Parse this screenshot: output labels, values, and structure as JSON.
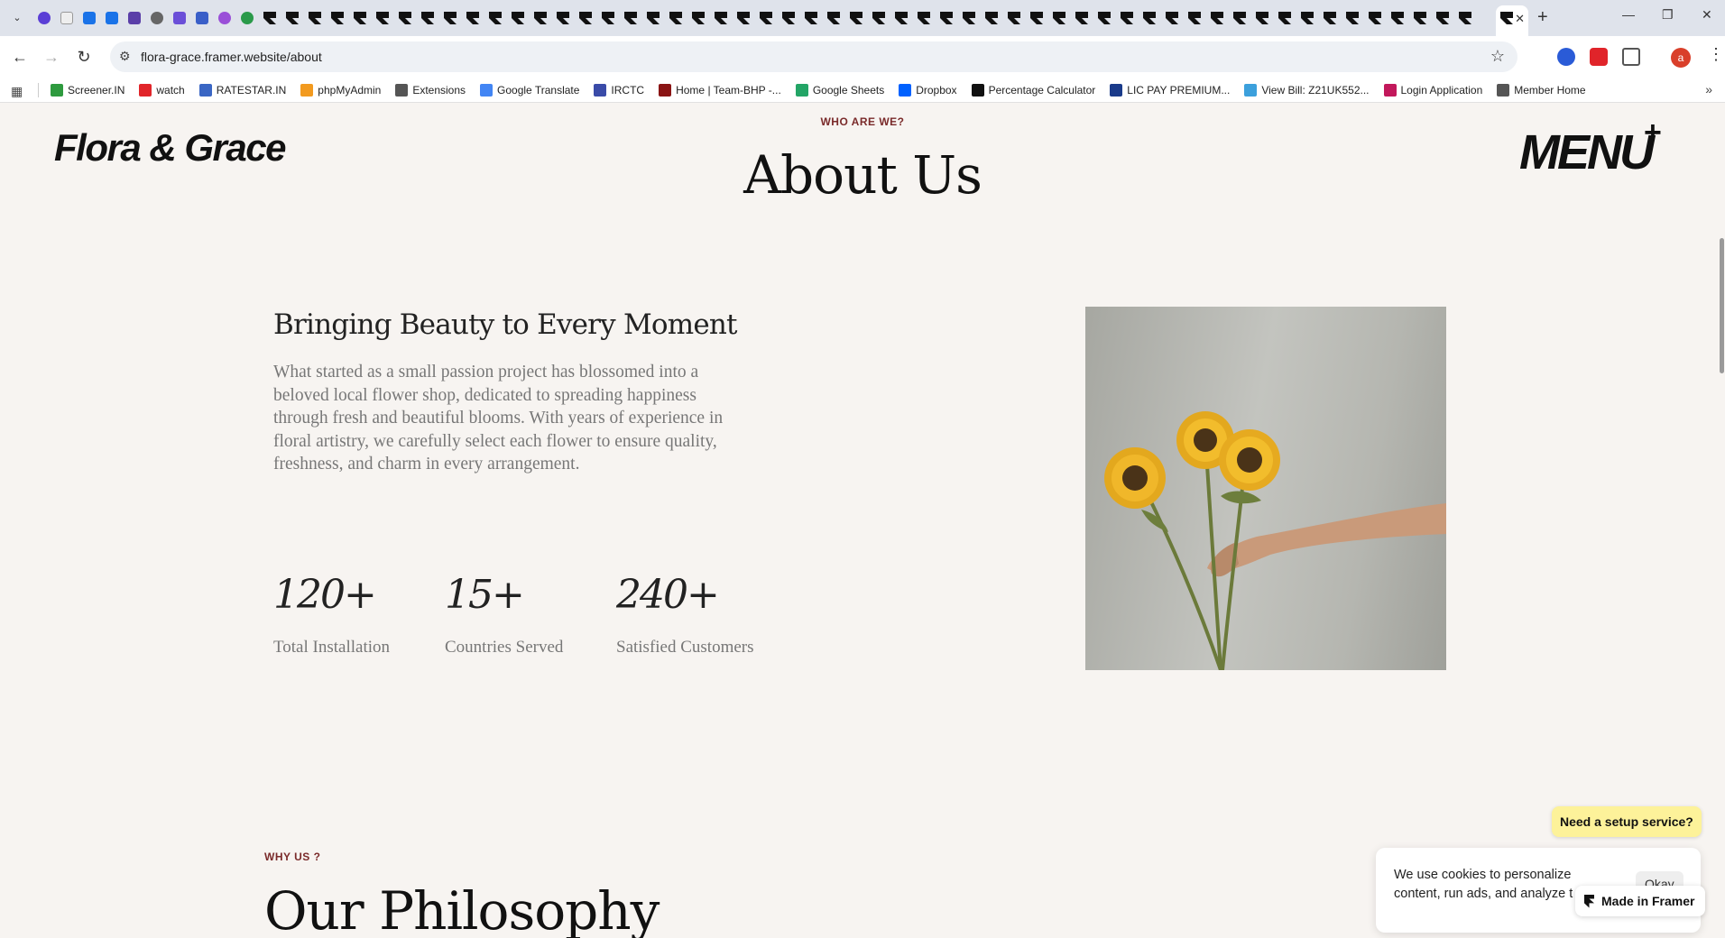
{
  "browser": {
    "url": "flora-grace.framer.website/about",
    "avatar_letter": "a",
    "bookmarks": [
      {
        "label": "Screener.IN",
        "color": "#2e9a3e"
      },
      {
        "label": "watch",
        "color": "#e1252a"
      },
      {
        "label": "RATESTAR.IN",
        "color": "#3a66c4"
      },
      {
        "label": "phpMyAdmin",
        "color": "#f29a1f"
      },
      {
        "label": "Extensions",
        "color": "#555555"
      },
      {
        "label": "Google Translate",
        "color": "#4285f4"
      },
      {
        "label": "IRCTC",
        "color": "#3a4ba8"
      },
      {
        "label": "Home | Team-BHP -...",
        "color": "#8a1414"
      },
      {
        "label": "Google Sheets",
        "color": "#23a566"
      },
      {
        "label": "Dropbox",
        "color": "#0061fe"
      },
      {
        "label": "Percentage Calculator",
        "color": "#111111"
      },
      {
        "label": "LIC PAY PREMIUM...",
        "color": "#1a3b8a"
      },
      {
        "label": "View Bill: Z21UK552...",
        "color": "#3ca0dc"
      },
      {
        "label": "Login Application",
        "color": "#c2185b"
      },
      {
        "label": "Member Home",
        "color": "#555555"
      }
    ]
  },
  "site": {
    "logo": "Flora & Grace",
    "menu_label": "MENU",
    "menu_plus": "+",
    "about": {
      "eyebrow": "WHO ARE WE?",
      "title": "About Us",
      "subtitle": "Bringing Beauty to Every Moment",
      "body": "What started as a small passion project has blossomed into a beloved local flower shop, dedicated to spreading happiness through fresh and beautiful blooms. With years of experience in floral artistry, we carefully select each flower to ensure quality, freshness, and charm in every arrangement."
    },
    "stats": [
      {
        "value": "120+",
        "label": "Total Installation"
      },
      {
        "value": "15+",
        "label": "Countries Served"
      },
      {
        "value": "240+",
        "label": "Satisfied Customers"
      }
    ],
    "philosophy": {
      "eyebrow": "WHY US ?",
      "title": "Our Philosophy"
    }
  },
  "overlays": {
    "setup_button": "Need a setup service?",
    "cookie_text": "We use cookies to personalize content, run ads, and analyze t",
    "cookie_ok": "Okay",
    "framer_badge": "Made in Framer"
  },
  "colors": {
    "page_bg": "#f7f4f1",
    "accent_eyebrow": "#7a2a2a",
    "setup_yellow": "#fdf29a"
  }
}
